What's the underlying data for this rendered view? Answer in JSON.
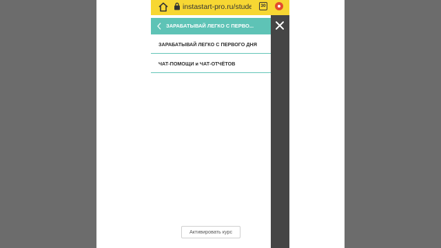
{
  "browser": {
    "url": "instastart-pro.ru/student",
    "tab_count": "30",
    "theme_color": "#f7d733"
  },
  "drawer": {
    "title": "ЗАРАБАТЫВАЙ ЛЕГКО С ПЕРВО...",
    "items": [
      {
        "label": "ЗАРАБАТЫВАЙ ЛЕГКО С ПЕРВОГО ДНЯ"
      },
      {
        "label": "ЧАТ-ПОМОЩИ и ЧАТ-ОТЧЁТОВ"
      }
    ],
    "activate_label": "Активировать курс",
    "accent_color": "#5ec3b6"
  },
  "icons": {
    "home": "home-icon",
    "lock": "lock-icon",
    "tabs": "tabs-icon",
    "menu": "menu-dot-icon",
    "back": "chevron-left-icon",
    "close": "close-icon"
  }
}
